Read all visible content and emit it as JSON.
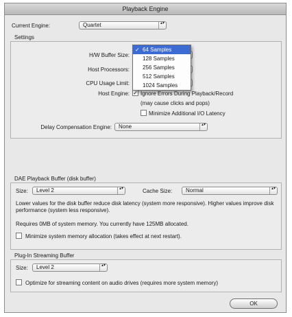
{
  "window": {
    "title": "Playback Engine"
  },
  "current_engine": {
    "label": "Current Engine:",
    "value": "Quartet"
  },
  "settings": {
    "heading": "Settings",
    "hw_buffer_size_label": "H/W Buffer Size:",
    "host_processors_label": "Host Processors:",
    "cpu_usage_limit_label": "CPU Usage Limit:",
    "host_engine_label": "Host Engine:",
    "ignore_errors_label": "Ignore Errors During Playback/Record",
    "ignore_errors_note": "(may cause clicks and pops)",
    "ignore_errors_checked": "✓",
    "minimize_io_label": "Minimize Additional I/O Latency",
    "delay_comp_label": "Delay Compensation Engine:",
    "delay_comp_value": "None"
  },
  "buffer_menu": {
    "items": [
      "64 Samples",
      "128 Samples",
      "256 Samples",
      "512 Samples",
      "1024 Samples"
    ],
    "selected_check": "✓"
  },
  "dae": {
    "heading": "DAE Playback Buffer (disk buffer)",
    "size_label": "Size:",
    "size_value": "Level 2",
    "cache_label": "Cache Size:",
    "cache_value": "Normal",
    "description": "Lower values for the disk buffer reduce disk latency (system more responsive). Higher values improve disk performance (system less responsive).",
    "memory_note": "Requires 0MB of system memory. You currently have 125MB allocated.",
    "minimize_memory_label": "Minimize system memory allocation (takes effect at next restart)."
  },
  "plugin": {
    "heading": "Plug-In Streaming Buffer",
    "size_label": "Size:",
    "size_value": "Level 2",
    "optimize_label": "Optimize for streaming content on audio drives (requires more system memory)"
  },
  "ok_button": "OK",
  "arrows_glyph": "▴▾"
}
